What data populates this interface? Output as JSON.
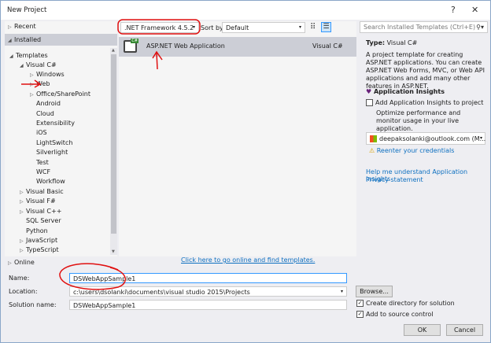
{
  "window": {
    "title": "New Project",
    "help": "?",
    "close": "✕"
  },
  "tree": {
    "recent": "Recent",
    "installed": "Installed",
    "online": "Online",
    "templates": "Templates",
    "visual_cs": "Visual C#",
    "cs_children": [
      "Windows",
      "Web",
      "Office/SharePoint",
      "Android",
      "Cloud",
      "Extensibility",
      "iOS",
      "LightSwitch",
      "Silverlight",
      "Test",
      "WCF",
      "Workflow"
    ],
    "languages": [
      "Visual Basic",
      "Visual F#",
      "Visual C++",
      "SQL Server",
      "Python",
      "JavaScript",
      "TypeScript"
    ]
  },
  "toolbar": {
    "framework": ".NET Framework 4.5.2",
    "sort_label": "Sort by:",
    "sort_value": "Default",
    "search_placeholder": "Search Installed Templates (Ctrl+E)"
  },
  "templates": [
    {
      "name": "ASP.NET Web Application",
      "lang": "Visual C#"
    }
  ],
  "online_link": "Click here to go online and find templates.",
  "details": {
    "type_label": "Type:",
    "type_value": "Visual C#",
    "description": "A project template for creating ASP.NET applications. You can create ASP.NET Web Forms, MVC,  or Web API applications and add many other features in ASP.NET.",
    "insights_title": "Application Insights",
    "insights_checkbox": "Add Application Insights to project",
    "insights_desc": "Optimize performance and monitor usage in your live application.",
    "account": "deepaksolanki@outlook.com (M...",
    "reenter": "Reenter your credentials",
    "help_link": "Help me understand Application Insights",
    "privacy_link": "Privacy statement"
  },
  "form": {
    "name_label": "Name:",
    "name_value": "DSWebAppSample1",
    "location_label": "Location:",
    "location_value": "c:\\users\\dsolanki\\documents\\visual studio 2015\\Projects",
    "solution_label": "Solution name:",
    "solution_value": "DSWebAppSample1",
    "browse": "Browse...",
    "create_dir": "Create directory for solution",
    "source_control": "Add to source control",
    "ok": "OK",
    "cancel": "Cancel"
  },
  "colors": {
    "annotation": "#e01010",
    "selected": "#ccced6",
    "link": "#0e70c0"
  }
}
